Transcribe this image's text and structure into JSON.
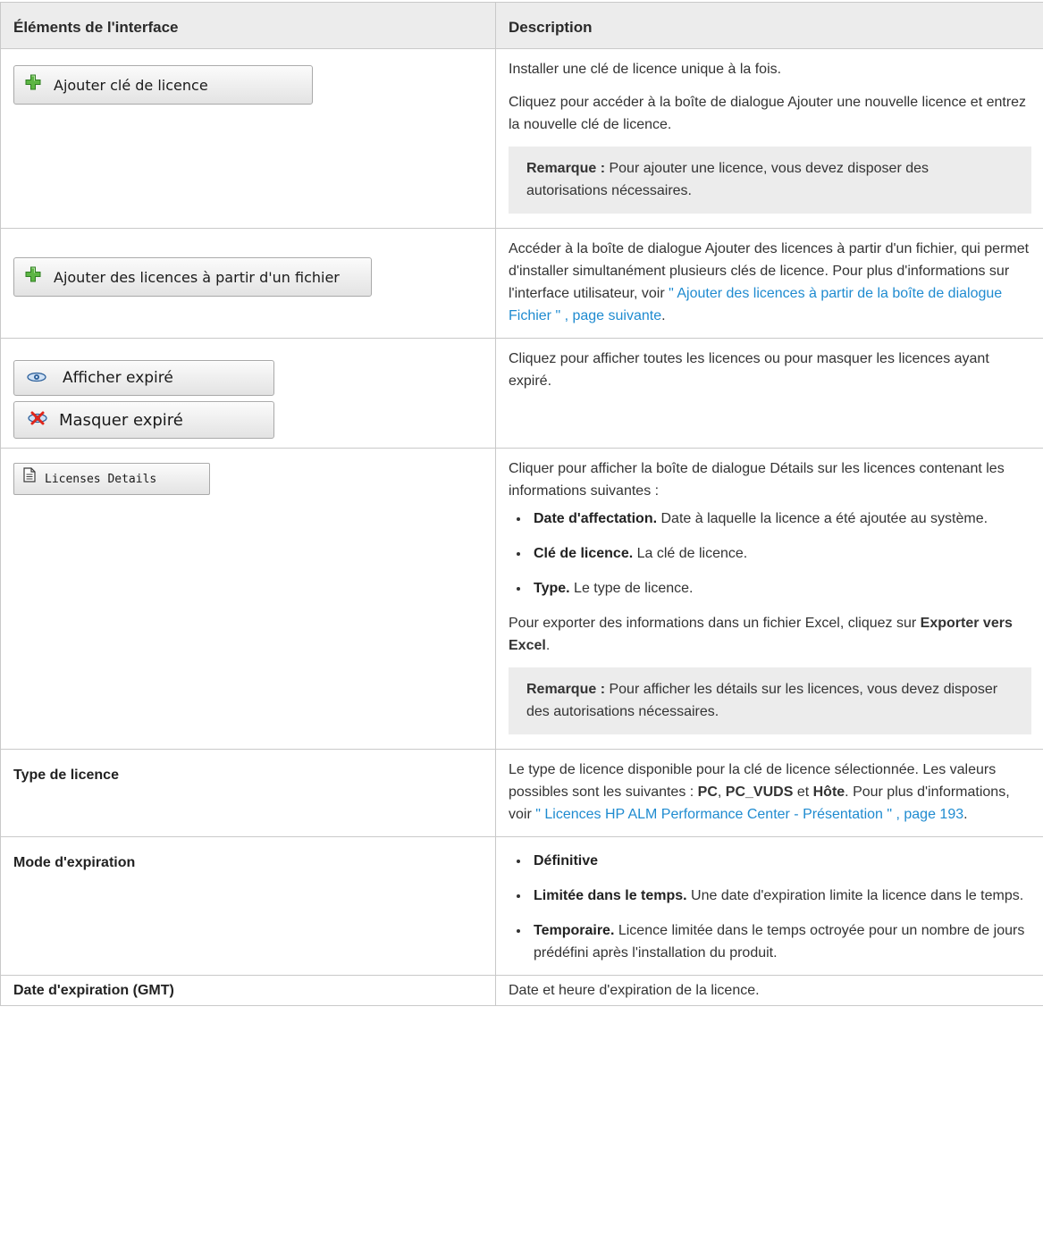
{
  "header": {
    "col1": "Éléments de l'interface",
    "col2": "Description"
  },
  "rows": {
    "add_key": {
      "button_label": "Ajouter clé de licence",
      "icon": "plus-icon",
      "p1": "Installer une clé de licence unique à la fois.",
      "p2": "Cliquez pour accéder à la boîte de dialogue Ajouter une nouvelle licence et entrez la nouvelle clé de licence.",
      "note_label": "Remarque :",
      "note_text": " Pour ajouter une licence, vous devez disposer des autorisations nécessaires."
    },
    "add_file": {
      "button_label": "Ajouter des licences à partir d'un fichier",
      "icon": "plus-icon",
      "text": "Accéder à la boîte de dialogue Ajouter des licences à partir d'un fichier, qui permet d'installer simultanément plusieurs clés de licence. Pour plus d'informations sur l'interface utilisateur, voir ",
      "link": "\" Ajouter des licences à partir de la boîte de dialogue Fichier \" , page suivante",
      "after": "."
    },
    "expired": {
      "show_label": "Afficher expiré",
      "show_icon": "eye-icon",
      "hide_label": "Masquer expiré",
      "hide_icon": "eye-crossed-icon",
      "text": "Cliquez pour afficher toutes les licences ou pour masquer les licences ayant expiré."
    },
    "details": {
      "button_label": "Licenses Details",
      "icon": "document-icon",
      "intro": "Cliquer pour afficher la boîte de dialogue Détails sur les licences contenant les informations suivantes :",
      "items": [
        {
          "term": "Date d'affectation.",
          "text": " Date à laquelle la licence a été ajoutée au système."
        },
        {
          "term": "Clé de licence.",
          "text": " La clé de licence."
        },
        {
          "term": "Type.",
          "text": " Le type de licence."
        }
      ],
      "export_text": "Pour exporter des informations dans un fichier Excel, cliquez sur ",
      "export_bold": "Exporter vers Excel",
      "export_after": ".",
      "note_label": "Remarque :",
      "note_text": " Pour afficher les détails sur les licences, vous devez disposer des autorisations nécessaires."
    },
    "license_type": {
      "term": "Type de licence",
      "t1": "Le type de licence disponible pour la clé de licence sélectionnée. Les valeurs possibles sont les suivantes : ",
      "v1": "PC",
      "sep1": ", ",
      "v2": "PC_VUDS",
      "sep2": " et ",
      "v3": "Hôte",
      "t2": ". Pour plus d'informations, voir ",
      "link": "\" Licences HP ALM Performance Center - Présentation \" , page 193",
      "after": "."
    },
    "expiration_mode": {
      "term": "Mode d'expiration",
      "items": [
        {
          "term": "Définitive",
          "text": ""
        },
        {
          "term": "Limitée dans le temps.",
          "text": " Une date d'expiration limite la licence dans le temps."
        },
        {
          "term": "Temporaire.",
          "text": " Licence limitée dans le temps octroyée pour un nombre de jours prédéfini après l'installation du produit."
        }
      ]
    },
    "expiration_date": {
      "term": "Date d'expiration (GMT)",
      "text": "Date et heure d'expiration de la licence."
    }
  }
}
